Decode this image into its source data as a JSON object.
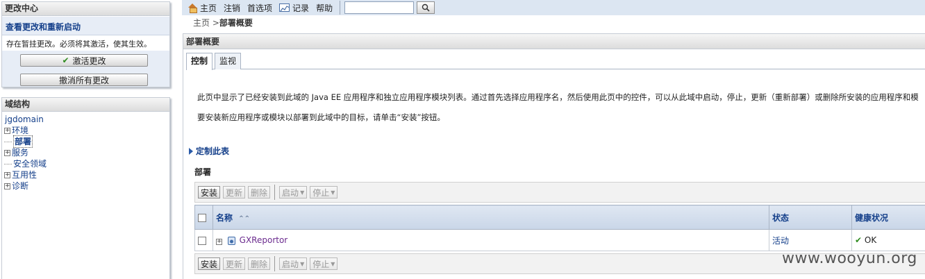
{
  "change_center": {
    "title": "更改中心",
    "view_link": "查看更改和重新启动",
    "status": "存在暂挂更改。必须将其激活，使其生效。",
    "activate_label": "激活更改",
    "undo_label": "撤消所有更改"
  },
  "domain_structure": {
    "title": "域结构",
    "root": "jgdomain",
    "items": [
      {
        "label": "环境",
        "expander": "+"
      },
      {
        "label": "部署",
        "expander": ""
      },
      {
        "label": "服务",
        "expander": "+"
      },
      {
        "label": "安全领域",
        "expander": ""
      },
      {
        "label": "互用性",
        "expander": "+"
      },
      {
        "label": "诊断",
        "expander": "+"
      }
    ]
  },
  "topbar": {
    "home": "主页",
    "logout": "注销",
    "preferences": "首选项",
    "record": "记录",
    "help": "帮助",
    "search_value": ""
  },
  "breadcrumb": {
    "home": "主页",
    "sep": " >",
    "current": "部署概要"
  },
  "main": {
    "title": "部署概要",
    "tabs": [
      {
        "label": "控制",
        "active": true
      },
      {
        "label": "监视",
        "active": false
      }
    ],
    "desc1": "此页中显示了已经安装到此域的 Java EE 应用程序和独立应用程序模块列表。通过首先选择应用程序名，然后使用此页中的控件，可以从此域中启动，停止，更新（重新部署）或删除所安装的应用程序和模",
    "desc2": "要安装新应用程序或模块以部署到此域中的目标，请单击“安装”按钮。",
    "customize": "定制此表",
    "deployments_title": "部署",
    "toolbar": {
      "install": "安装",
      "update": "更新",
      "delete": "删除",
      "start": "启动",
      "stop": "停止"
    },
    "table": {
      "col_name": "名称",
      "col_status": "状态",
      "col_health": "健康状况",
      "rows": [
        {
          "name": "GXReportor",
          "status": "活动",
          "health": "OK"
        }
      ]
    }
  },
  "watermark": "www.wooyun.org"
}
